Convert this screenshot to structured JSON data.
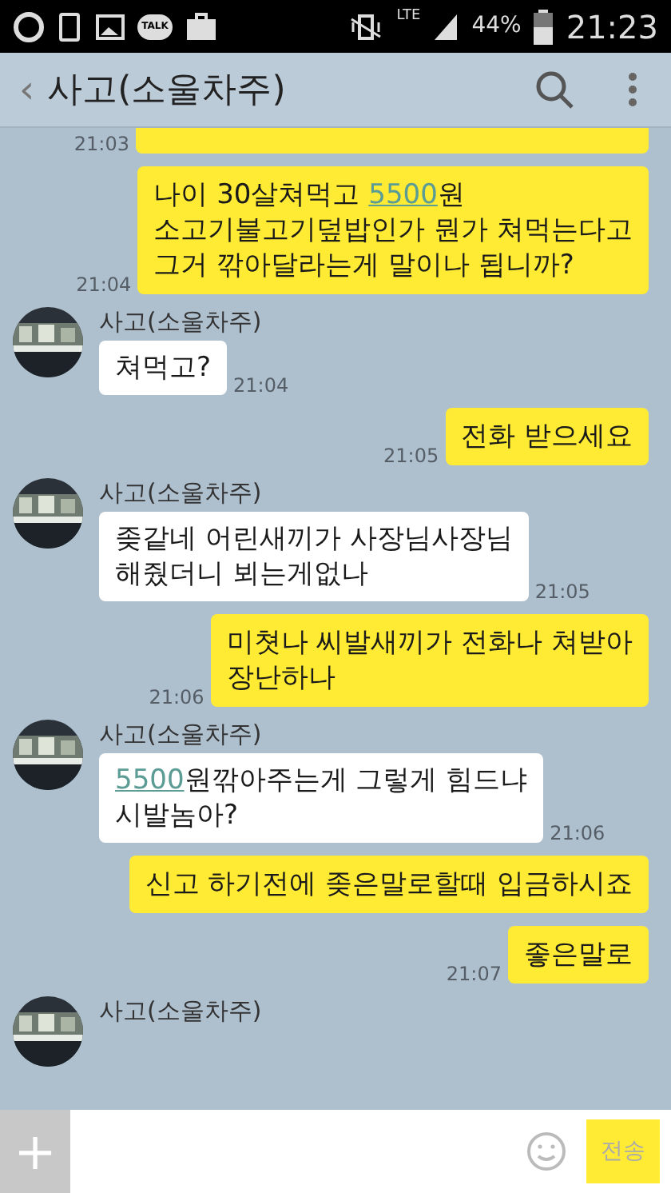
{
  "status_bar": {
    "talk_label": "TALK",
    "network": "LTE",
    "battery": "44%",
    "time": "21:23"
  },
  "header": {
    "back": "‹",
    "title": "사고(소울차주)"
  },
  "top_cut": {
    "time": "21:03"
  },
  "messages": [
    {
      "kind": "sent",
      "time": "21:04",
      "lines": [
        [
          {
            "kind": "text",
            "text": "나이 30살쳐먹고 "
          },
          {
            "kind": "link",
            "text": "5500"
          },
          {
            "kind": "text",
            "text": "원"
          }
        ],
        [
          {
            "kind": "text",
            "text": "소고기불고기덮밥인가 뭔가 쳐먹는다고"
          }
        ],
        [
          {
            "kind": "text",
            "text": "그거 깎아달라는게 말이나 됩니까?"
          }
        ]
      ]
    },
    {
      "kind": "received",
      "name": "사고(소울차주)",
      "time": "21:04",
      "lines": [
        [
          {
            "kind": "text",
            "text": "쳐먹고?"
          }
        ]
      ]
    },
    {
      "kind": "sent",
      "time": "21:05",
      "lines": [
        [
          {
            "kind": "text",
            "text": "전화 받으세요"
          }
        ]
      ]
    },
    {
      "kind": "received",
      "name": "사고(소울차주)",
      "time": "21:05",
      "lines": [
        [
          {
            "kind": "text",
            "text": "좆같네 어린새끼가 사장님사장님"
          }
        ],
        [
          {
            "kind": "text",
            "text": "해줬더니 뵈는게없나"
          }
        ]
      ]
    },
    {
      "kind": "sent",
      "time": "21:06",
      "lines": [
        [
          {
            "kind": "text",
            "text": "미쳣나 씨발새끼가 전화나 쳐받아"
          }
        ],
        [
          {
            "kind": "text",
            "text": "장난하나"
          }
        ]
      ]
    },
    {
      "kind": "received",
      "name": "사고(소울차주)",
      "time": "21:06",
      "lines": [
        [
          {
            "kind": "link",
            "text": "5500"
          },
          {
            "kind": "text",
            "text": "원깎아주는게 그렇게 힘드냐"
          }
        ],
        [
          {
            "kind": "text",
            "text": "시발놈아?"
          }
        ]
      ]
    },
    {
      "kind": "sent",
      "lines": [
        [
          {
            "kind": "text",
            "text": "신고 하기전에 좆은말로할때 입금하시죠"
          }
        ]
      ]
    },
    {
      "kind": "sent",
      "time": "21:07",
      "lines": [
        [
          {
            "kind": "text",
            "text": "좋은말로"
          }
        ]
      ]
    },
    {
      "kind": "received",
      "name": "사고(소울차주)"
    }
  ],
  "input_bar": {
    "plus": "+",
    "send": "전송"
  }
}
